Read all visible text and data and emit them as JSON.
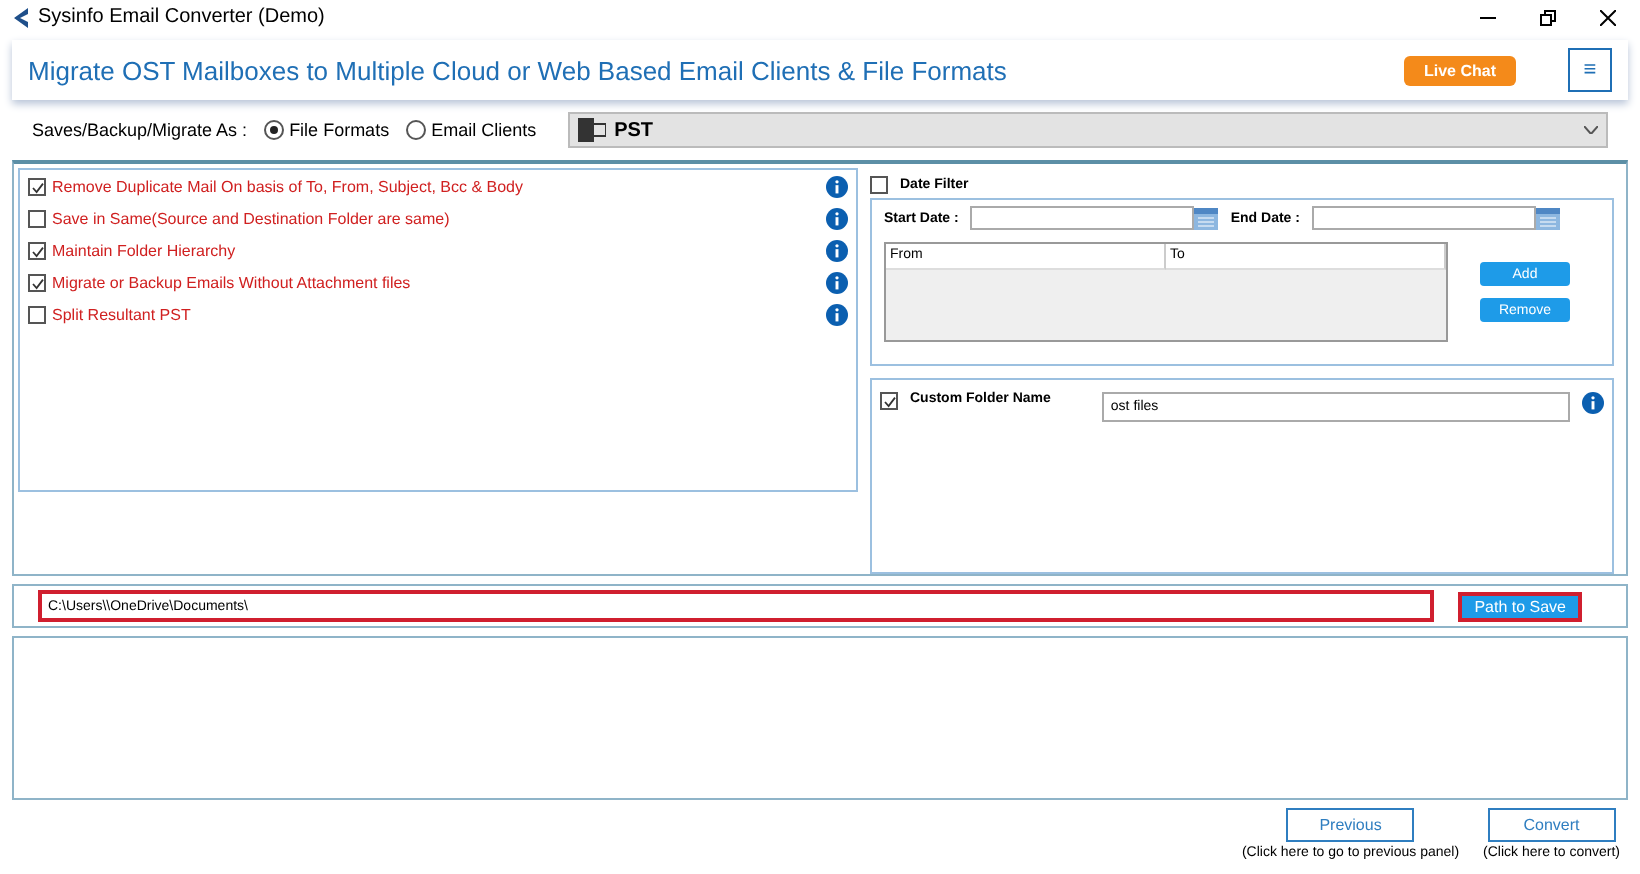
{
  "window": {
    "title": "Sysinfo Email Converter (Demo)"
  },
  "header": {
    "title": "Migrate OST Mailboxes to Multiple Cloud or Web Based Email Clients & File Formats",
    "live_chat": "Live Chat",
    "menu": "≡"
  },
  "save_as": {
    "label": "Saves/Backup/Migrate As :",
    "options": [
      {
        "label": "File Formats",
        "selected": true
      },
      {
        "label": "Email Clients",
        "selected": false
      }
    ],
    "format": "PST"
  },
  "options": [
    {
      "label": "Remove Duplicate Mail On basis of To, From, Subject, Bcc & Body",
      "checked": true
    },
    {
      "label": "Save in Same(Source and Destination Folder are same)",
      "checked": false
    },
    {
      "label": "Maintain Folder Hierarchy",
      "checked": true
    },
    {
      "label": "Migrate or Backup Emails Without Attachment files",
      "checked": true
    },
    {
      "label": "Split Resultant PST",
      "checked": false
    }
  ],
  "date_filter": {
    "label": "Date Filter",
    "checked": false,
    "start_label": "Start Date :",
    "end_label": "End Date :",
    "columns": [
      "From",
      "To"
    ],
    "add": "Add",
    "remove": "Remove"
  },
  "custom_folder": {
    "label": "Custom Folder Name",
    "checked": true,
    "value": "ost files"
  },
  "path": {
    "value": "C:\\Users\\\\OneDrive\\Documents\\",
    "button": "Path to Save"
  },
  "footer": [
    {
      "button": "Previous",
      "hint": "(Click here to go to previous panel)"
    },
    {
      "button": "Convert",
      "hint": "(Click here to convert)"
    }
  ]
}
